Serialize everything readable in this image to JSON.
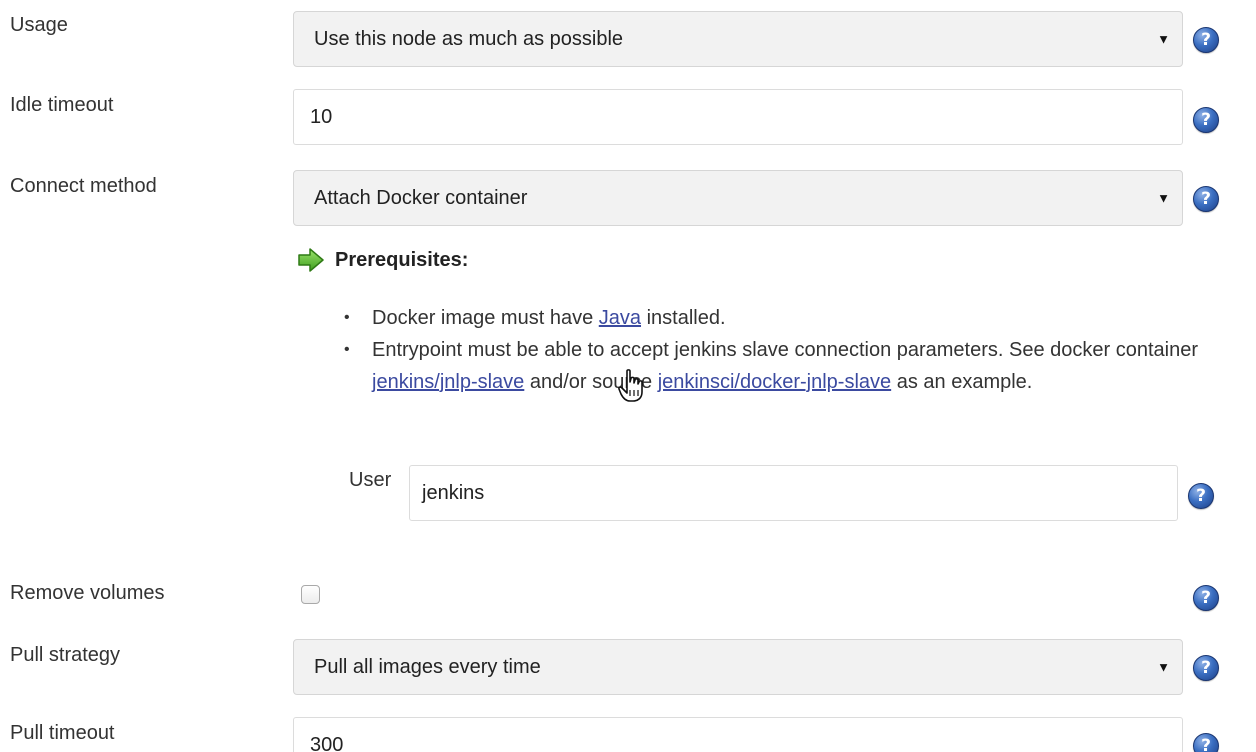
{
  "form": {
    "usage": {
      "label": "Usage",
      "selected": "Use this node as much as possible"
    },
    "idle_timeout": {
      "label": "Idle timeout",
      "value": "10"
    },
    "connect_method": {
      "label": "Connect method",
      "selected": "Attach Docker container",
      "prerequisites": {
        "heading": "Prerequisites:",
        "bullet1": {
          "before": "Docker image must have ",
          "link": "Java",
          "after": " installed."
        },
        "bullet2": {
          "before": "Entrypoint must be able to accept jenkins slave connection parameters. See docker container ",
          "link1": "jenkins/jnlp-slave",
          "middle": " and/or source ",
          "link2": "jenkinsci/docker-jnlp-slave",
          "after": " as an example."
        }
      },
      "user": {
        "label": "User",
        "value": "jenkins"
      }
    },
    "remove_volumes": {
      "label": "Remove volumes",
      "checked": false
    },
    "pull_strategy": {
      "label": "Pull strategy",
      "selected": "Pull all images every time"
    },
    "pull_timeout": {
      "label": "Pull timeout",
      "value": "300"
    }
  },
  "icons": {
    "help": "help-icon",
    "caret": "dropdown-caret-icon",
    "arrow": "green-arrow-icon",
    "cursor": "hand-pointer-cursor"
  },
  "colors": {
    "link": "#3b4aa0",
    "select_bg": "#f2f2f2",
    "help_blue": "#3b6fc2"
  }
}
